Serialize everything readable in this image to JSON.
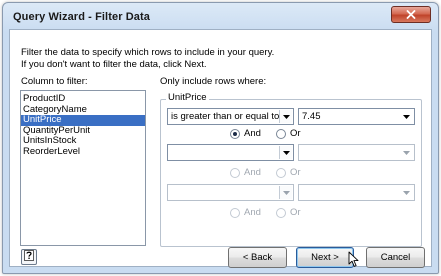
{
  "window": {
    "title": "Query Wizard - Filter Data"
  },
  "instructions": {
    "line1": "Filter the data to specify which rows to include in your query.",
    "line2": "If you don't want to filter the data, click Next."
  },
  "columns_panel": {
    "label": "Column to filter:",
    "items": [
      "ProductID",
      "CategoryName",
      "UnitPrice",
      "QuantityPerUnit",
      "UnitsInStock",
      "ReorderLevel"
    ],
    "selected": "UnitPrice"
  },
  "filter_panel": {
    "label": "Only include rows where:",
    "group_title": "UnitPrice",
    "rows": [
      {
        "operator": "is greater than or equal to",
        "value": "7.45",
        "enabled": true
      },
      {
        "operator": "",
        "value": "",
        "enabled": true
      },
      {
        "operator": "",
        "value": "",
        "enabled": false
      }
    ],
    "logic": [
      {
        "and_label": "And",
        "or_label": "Or",
        "selected": "And",
        "enabled": true
      },
      {
        "and_label": "And",
        "or_label": "Or",
        "selected": "",
        "enabled": false
      },
      {
        "and_label": "And",
        "or_label": "Or",
        "selected": "",
        "enabled": false
      }
    ]
  },
  "buttons": {
    "back": "< Back",
    "next": "Next >",
    "cancel": "Cancel"
  },
  "icons": {
    "close": "close-icon",
    "help": "help-icon",
    "dropdown": "chevron-down-icon",
    "cursor": "mouse-pointer-icon"
  }
}
